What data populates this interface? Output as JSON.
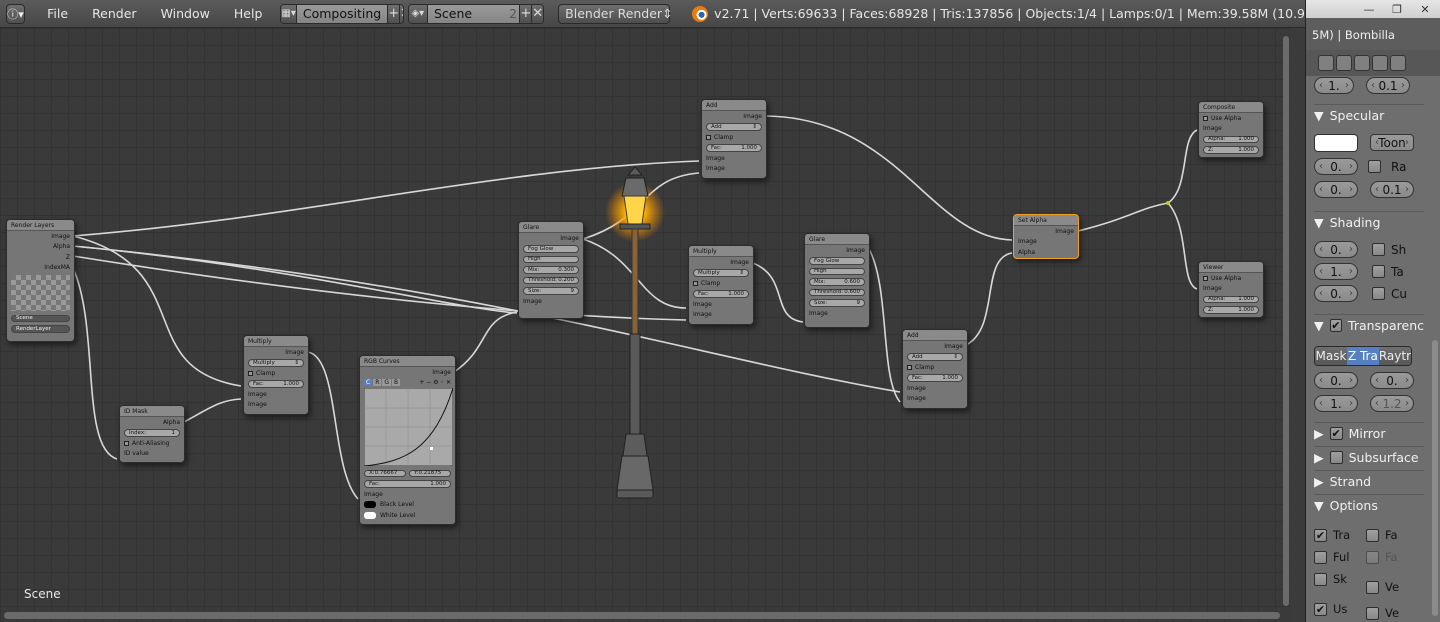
{
  "topbar": {
    "info_icon": "info-icon",
    "menus": [
      "File",
      "Render",
      "Window",
      "Help"
    ],
    "screen": {
      "name": "Compositing"
    },
    "scene": {
      "name": "Scene",
      "users": "2"
    },
    "renderer": "Blender Render",
    "stats": "v2.71 | Verts:69633 | Faces:68928 | Tris:137856 | Objects:1/4 | Lamps:0/1 | Mem:39.58M (10.9"
  },
  "editor": {
    "scene_label": "Scene",
    "nodes": {
      "render_layers": {
        "title": "Render Layers",
        "outputs": [
          "Image",
          "Alpha",
          "Z",
          "IndexMA"
        ],
        "scene": "Scene",
        "layer": "RenderLayer"
      },
      "id_mask": {
        "title": "ID Mask",
        "output": "Alpha",
        "index": "Index:",
        "index_val": "1",
        "aa": "Anti-Aliasing",
        "input": "ID value"
      },
      "multiply1": {
        "title": "Multiply",
        "output": "Image",
        "mode": "Multiply",
        "clamp": "Clamp",
        "fac": "Fac:",
        "fac_val": "1.000",
        "in1": "Image",
        "in2": "Image"
      },
      "rgb_curves": {
        "title": "RGB Curves",
        "output": "Image",
        "x": "X:0.76667",
        "y": "Y:0.21875",
        "fac": "Fac:",
        "fac_val": "1.000",
        "in_image": "Image",
        "black": "Black Level",
        "white": "White Level",
        "channels": [
          "C",
          "R",
          "G",
          "B"
        ]
      },
      "glare1": {
        "title": "Glare",
        "output": "Image",
        "type": "Fog Glow",
        "quality": "High",
        "mix": "Mix:",
        "mix_val": "0.300",
        "threshold": "Threshold:",
        "threshold_val": "0.200",
        "size": "Size:",
        "size_val": "9",
        "input": "Image"
      },
      "add1": {
        "title": "Add",
        "output": "Image",
        "mode": "Add",
        "clamp": "Clamp",
        "fac": "Fac:",
        "fac_val": "1.000",
        "in1": "Image",
        "in2": "Image"
      },
      "multiply2": {
        "title": "Multiply",
        "output": "Image",
        "mode": "Multiply",
        "clamp": "Clamp",
        "fac": "Fac:",
        "fac_val": "1.000",
        "in1": "Image",
        "in2": "Image"
      },
      "glare2": {
        "title": "Glare",
        "output": "Image",
        "type": "Fog Glow",
        "quality": "High",
        "mix": "Mix:",
        "mix_val": "0.600",
        "threshold": "Threshold:",
        "threshold_val": "0.600",
        "size": "Size:",
        "size_val": "9",
        "input": "Image"
      },
      "add2": {
        "title": "Add",
        "output": "Image",
        "mode": "Add",
        "clamp": "Clamp",
        "fac": "Fac:",
        "fac_val": "1.000",
        "in1": "Image",
        "in2": "Image"
      },
      "set_alpha": {
        "title": "Set Alpha",
        "output": "Image",
        "in1": "Image",
        "in2": "Alpha"
      },
      "composite": {
        "title": "Composite",
        "use_alpha": "Use Alpha",
        "image": "Image",
        "alpha": "Alpha:",
        "alpha_val": "1.000",
        "z": "Z:",
        "z_val": "1.000"
      },
      "viewer": {
        "title": "Viewer",
        "use_alpha": "Use Alpha",
        "image": "Image",
        "alpha": "Alpha:",
        "alpha_val": "1.000",
        "z": "Z:",
        "z_val": "1.000"
      }
    }
  },
  "properties": {
    "window_buttons": [
      "—",
      "❐",
      "✕"
    ],
    "title": "5M) | Bombilla",
    "field_a": "1.",
    "field_b": "0.1",
    "specular": "Specular",
    "spec_shader": "Toon",
    "spec_int": "0.",
    "spec_ramp": "Ra",
    "spec_f1": "0.",
    "spec_f2": "0.1",
    "shading": "Shading",
    "sh_f1": "0.",
    "sh_c1": "Sh",
    "sh_f2": "1.",
    "sh_c2": "Ta",
    "sh_f3": "0.",
    "sh_c3": "Cu",
    "transparency": "Transparenc",
    "seg": [
      "Mask",
      "Z Tra",
      "Raytr"
    ],
    "tr_f1": "0.",
    "tr_f2": "0.",
    "tr_f3": "1.",
    "tr_f4": "1.2",
    "mirror": "Mirror",
    "subsurface": "Subsurface",
    "strand": "Strand",
    "options": "Options",
    "opt": [
      "Tra",
      "Fa",
      "Ful",
      "Fa",
      "Sk",
      "Ve",
      "Us",
      "Ve"
    ]
  }
}
